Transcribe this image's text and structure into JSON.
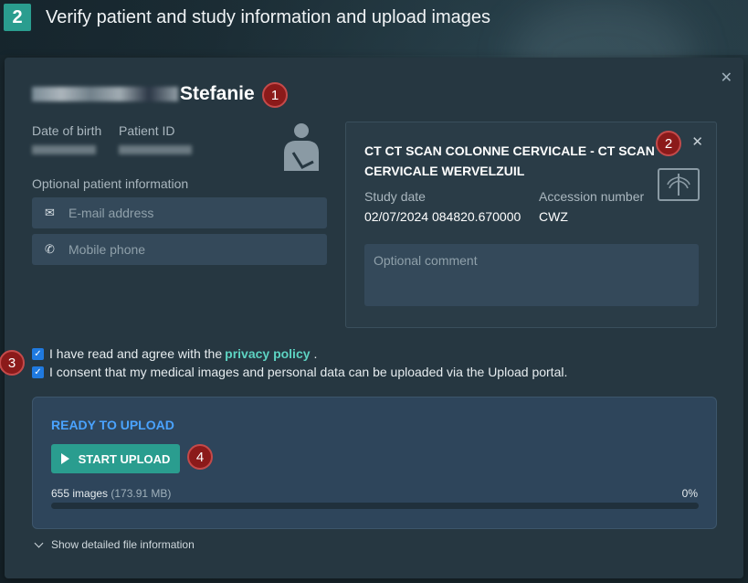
{
  "step": {
    "number": "2",
    "title": "Verify patient and study information and upload images"
  },
  "patient": {
    "name_visible": "Stefanie",
    "dob_label": "Date of birth",
    "patient_id_label": "Patient ID",
    "optional_info_label": "Optional patient information",
    "email_placeholder": "E-mail address",
    "phone_placeholder": "Mobile phone"
  },
  "study": {
    "title": "CT CT SCAN COLONNE CERVICALE - CT SCAN CERVICALE WERVELZUIL",
    "study_date_label": "Study date",
    "study_date_value": "02/07/2024 084820.670000",
    "accession_label": "Accession number",
    "accession_value": "CWZ",
    "comment_placeholder": "Optional comment"
  },
  "consent": {
    "privacy_prefix": "I have read and agree with the",
    "privacy_link": "privacy policy",
    "privacy_suffix": ".",
    "upload_consent": "I consent that my medical images and personal data can be uploaded via the Upload portal."
  },
  "upload": {
    "status": "READY TO UPLOAD",
    "start_button": "START UPLOAD",
    "images_count": "655 images",
    "images_size": "(173.91 MB)",
    "percent": "0%",
    "progress_fraction": 0,
    "show_details": "Show detailed file information"
  },
  "markers": [
    "1",
    "2",
    "3",
    "4"
  ],
  "colors": {
    "accent": "#2a9d8f",
    "status_blue": "#4aa3ff",
    "marker_red": "#8b1a1a",
    "link_teal": "#5dd3c2"
  }
}
